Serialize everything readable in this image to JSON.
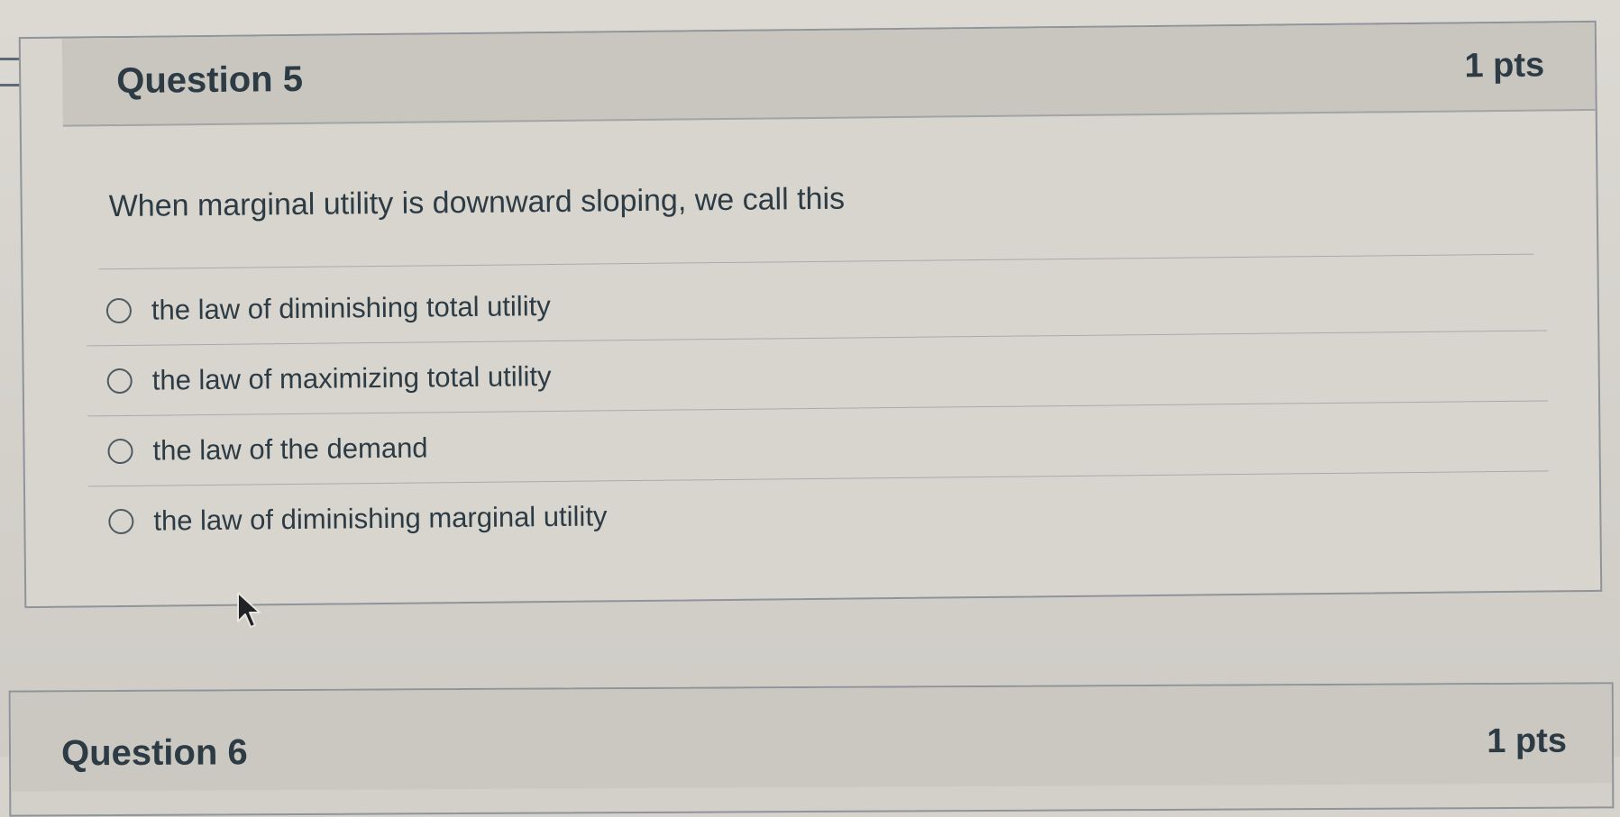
{
  "questions": [
    {
      "title": "Question 5",
      "points": "1 pts",
      "text": "When marginal utility is downward sloping, we call this",
      "answers": [
        "the law of diminishing total utility",
        "the law of maximizing total utility",
        "the law of the demand",
        "the law of diminishing marginal utility"
      ]
    },
    {
      "title": "Question 6",
      "points": "1 pts"
    }
  ],
  "icons": {
    "bookmark": "bookmark-flag-icon",
    "radio": "radio-unselected-icon",
    "cursor": "mouse-pointer-icon"
  },
  "colors": {
    "text": "#2d3b45",
    "header_bg": "#c9c6c0",
    "card_bg": "#d8d5ce",
    "border": "#8e9499"
  }
}
